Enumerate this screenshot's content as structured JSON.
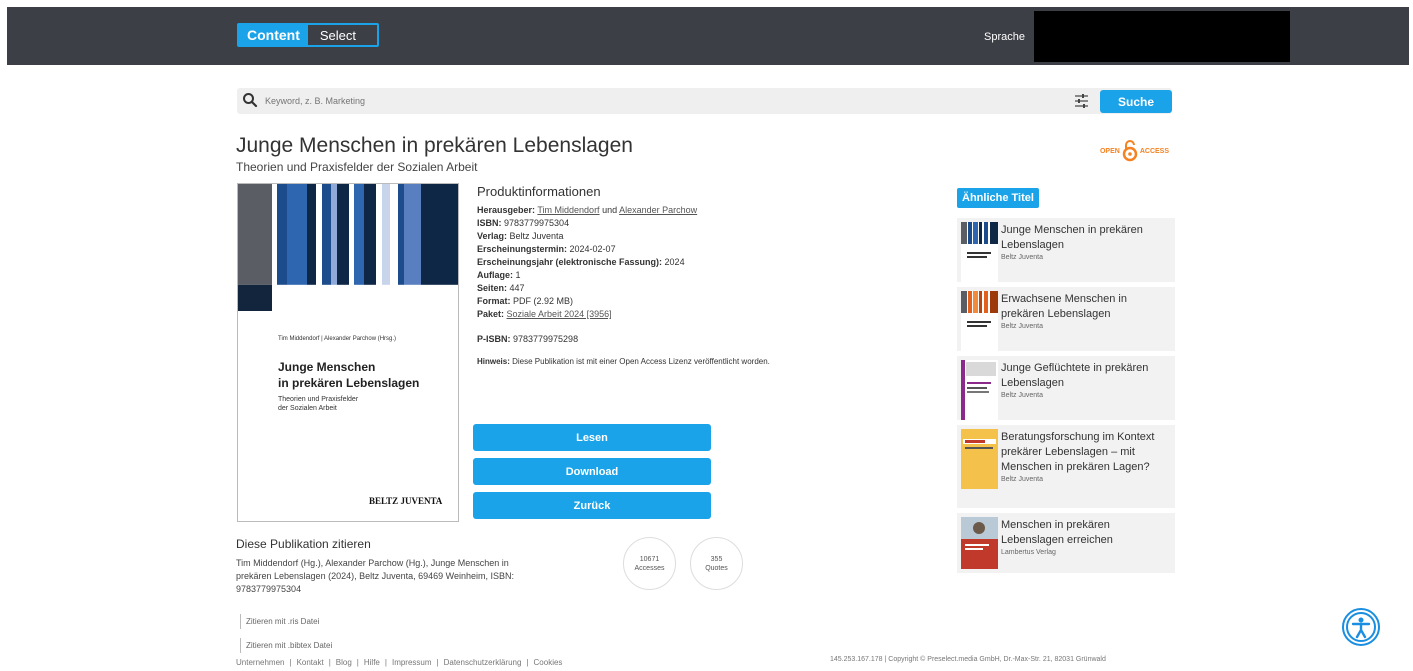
{
  "header": {
    "brand_content": "Content",
    "brand_select": "Select",
    "language_label": "Sprache"
  },
  "search": {
    "placeholder": "Keyword, z. B. Marketing",
    "button": "Suche"
  },
  "book": {
    "title": "Junge Menschen in prekären Lebenslagen",
    "subtitle": "Theorien und Praxisfelder der Sozialen Arbeit",
    "oa_left": "OPEN",
    "oa_right": "ACCESS"
  },
  "cover": {
    "author": "Tim Middendorf | Alexander Parchow (Hrsg.)",
    "title_line1": "Junge Menschen",
    "title_line2": "in prekären Lebenslagen",
    "sub_line1": "Theorien und Praxisfelder",
    "sub_line2": "der Sozialen Arbeit",
    "publisher": "BELTZ JUVENTA"
  },
  "product": {
    "heading": "Produktinformationen",
    "editor_label": "Herausgeber:",
    "editor1": "Tim Middendorf",
    "editor_and": " und ",
    "editor2": "Alexander Parchow",
    "isbn_label": "ISBN:",
    "isbn": " 9783779975304",
    "publisher_label": "Verlag:",
    "publisher": " Beltz Juventa",
    "date_label": "Erscheinungstermin:",
    "date": " 2024-02-07",
    "year_label": "Erscheinungsjahr (elektronische Fassung):",
    "year": " 2024",
    "edition_label": "Auflage:",
    "edition": " 1",
    "pages_label": "Seiten:",
    "pages": " 447",
    "format_label": "Format:",
    "format": " PDF (2.92 MB)",
    "package_label": "Paket:",
    "package": "Soziale Arbeit 2024 [3956]",
    "pisbn_label": "P-ISBN:",
    "pisbn": " 9783779975298",
    "note_label": "Hinweis:",
    "note": " Diese Publikation ist mit einer Open Access Lizenz veröffentlicht worden."
  },
  "actions": {
    "read": "Lesen",
    "download": "Download",
    "back": "Zurück"
  },
  "cite": {
    "heading": "Diese Publikation zitieren",
    "text": "Tim Middendorf (Hg.), Alexander Parchow (Hg.), Junge Menschen in prekären Lebenslagen (2024), Beltz Juventa, 69469 Weinheim, ISBN: 9783779975304",
    "ris": "Zitieren mit .ris Datei",
    "bibtex": "Zitieren mit .bibtex Datei"
  },
  "stats": {
    "accesses_value": "10671",
    "accesses_label": "Accesses",
    "quotes_value": "355",
    "quotes_label": "Quotes"
  },
  "similar": {
    "heading": "Ähnliche Titel",
    "items": [
      {
        "title": "Junge Menschen in prekären Lebenslagen",
        "publisher": "Beltz Juventa"
      },
      {
        "title": "Erwachsene Menschen in prekären Lebenslagen",
        "publisher": "Beltz Juventa"
      },
      {
        "title": "Junge Geflüchtete in prekären Lebenslagen",
        "publisher": "Beltz Juventa"
      },
      {
        "title": "Beratungsforschung im Kontext prekärer Lebenslagen – mit Menschen in prekären Lagen?",
        "publisher": "Beltz Juventa"
      },
      {
        "title": "Menschen in prekären Lebenslagen erreichen",
        "publisher": "Lambertus Verlag"
      }
    ]
  },
  "footer": {
    "links": [
      "Unternehmen",
      "Kontakt",
      "Blog",
      "Hilfe",
      "Impressum",
      "Datenschutzerklärung",
      "Cookies"
    ],
    "ip": "145.253.167.178",
    "copyright": "Copyright © Preselect.media GmbH, Dr.-Max-Str. 21, 82031 Grünwald"
  },
  "colors": {
    "accent": "#1aa3e8",
    "header_bg": "#3c3f46",
    "open_access": "#f58220"
  }
}
